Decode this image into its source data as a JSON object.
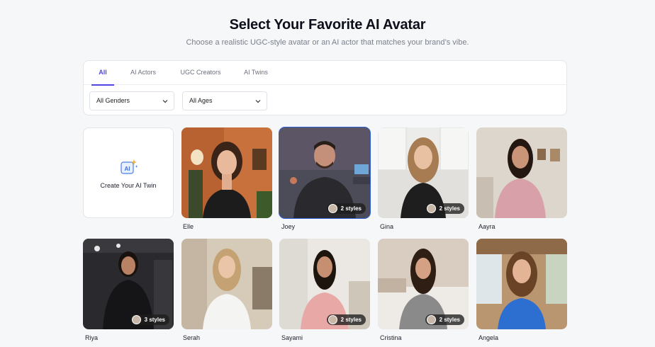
{
  "header": {
    "title": "Select Your Favorite AI Avatar",
    "subtitle": "Choose a realistic UGC-style avatar or an AI actor that matches your brand’s vibe."
  },
  "tabs": [
    {
      "label": "All",
      "active": true
    },
    {
      "label": "AI Actors",
      "active": false
    },
    {
      "label": "UGC Creators",
      "active": false
    },
    {
      "label": "AI Twins",
      "active": false
    }
  ],
  "filters": {
    "gender": "All Genders",
    "age": "All Ages"
  },
  "create_card": {
    "label": "Create Your AI Twin",
    "icon": "ai-sparkle-icon"
  },
  "avatars": [
    {
      "name": "Elle",
      "styles": null
    },
    {
      "name": "Joey",
      "styles": "2 styles",
      "selected": true
    },
    {
      "name": "Gina",
      "styles": "2 styles"
    },
    {
      "name": "Aayra",
      "styles": null
    },
    {
      "name": "Riya",
      "styles": "3 styles"
    },
    {
      "name": "Serah",
      "styles": null
    },
    {
      "name": "Sayami",
      "styles": "2 styles"
    },
    {
      "name": "Cristina",
      "styles": "2 styles"
    },
    {
      "name": "Angela",
      "styles": null
    }
  ],
  "colors": {
    "accent": "#4f46e5",
    "selected_border": "#2e5fd6",
    "background": "#f6f7f9"
  }
}
